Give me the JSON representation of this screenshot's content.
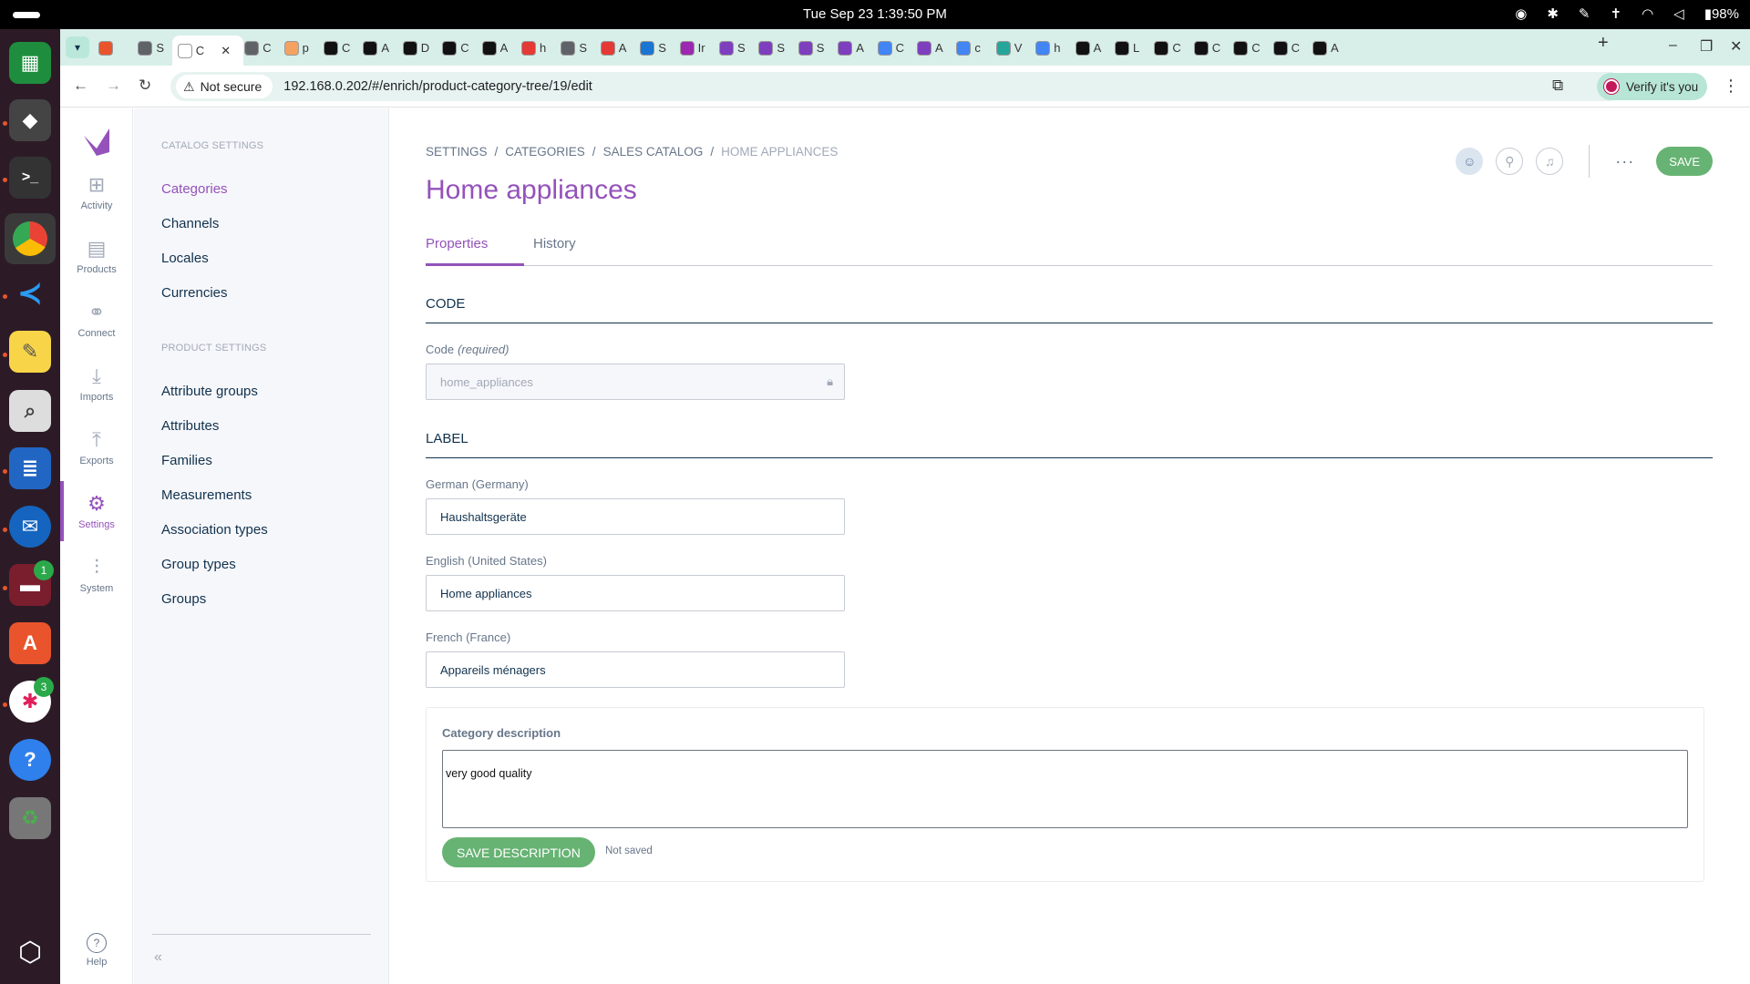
{
  "os": {
    "clock": "Tue Sep 23   1:39:50 PM",
    "battery": "98%"
  },
  "browser": {
    "tabs": [
      {
        "label": "",
        "color": "#e9542c"
      },
      {
        "label": "S",
        "color": "#5f6368"
      },
      {
        "label": "C",
        "color": "#ffffff"
      },
      {
        "label": "C",
        "color": "#5f6368"
      },
      {
        "label": "p",
        "color": "#f4a261"
      },
      {
        "label": "C",
        "color": "#111111"
      },
      {
        "label": "A",
        "color": "#111111"
      },
      {
        "label": "D",
        "color": "#111111"
      },
      {
        "label": "C",
        "color": "#111111"
      },
      {
        "label": "A",
        "color": "#111111"
      },
      {
        "label": "h",
        "color": "#e53935"
      },
      {
        "label": "S",
        "color": "#5f6368"
      },
      {
        "label": "A",
        "color": "#e53935"
      },
      {
        "label": "S",
        "color": "#1976d2"
      },
      {
        "label": "Ir",
        "color": "#9c27b0"
      },
      {
        "label": "S",
        "color": "#7e3fbf"
      },
      {
        "label": "S",
        "color": "#7e3fbf"
      },
      {
        "label": "S",
        "color": "#7e3fbf"
      },
      {
        "label": "A",
        "color": "#7e3fbf"
      },
      {
        "label": "C",
        "color": "#4285f4"
      },
      {
        "label": "A",
        "color": "#7e3fbf"
      },
      {
        "label": "c",
        "color": "#4285f4"
      },
      {
        "label": "V",
        "color": "#26a69a"
      },
      {
        "label": "h",
        "color": "#4285f4"
      },
      {
        "label": "A",
        "color": "#111111"
      },
      {
        "label": "L",
        "color": "#111111"
      },
      {
        "label": "C",
        "color": "#111111"
      },
      {
        "label": "C",
        "color": "#111111"
      },
      {
        "label": "C",
        "color": "#111111"
      },
      {
        "label": "C",
        "color": "#111111"
      },
      {
        "label": "A",
        "color": "#111111"
      }
    ],
    "not_secure": "Not secure",
    "url": "192.168.0.202/#/enrich/product-category-tree/19/edit",
    "verify": "Verify it's you"
  },
  "main_menu": {
    "items": [
      {
        "label": "Activity",
        "icon": "activity-icon"
      },
      {
        "label": "Products",
        "icon": "products-icon"
      },
      {
        "label": "Connect",
        "icon": "connect-icon"
      },
      {
        "label": "Imports",
        "icon": "imports-icon"
      },
      {
        "label": "Exports",
        "icon": "exports-icon"
      },
      {
        "label": "Settings",
        "icon": "settings-icon"
      },
      {
        "label": "System",
        "icon": "system-icon"
      }
    ],
    "help": "Help"
  },
  "settings_panel": {
    "catalog_header": "CATALOG SETTINGS",
    "catalog_links": [
      "Categories",
      "Channels",
      "Locales",
      "Currencies"
    ],
    "product_header": "PRODUCT SETTINGS",
    "product_links": [
      "Attribute groups",
      "Attributes",
      "Families",
      "Measurements",
      "Association types",
      "Group types",
      "Groups"
    ]
  },
  "content": {
    "breadcrumb": [
      "SETTINGS",
      "CATEGORIES",
      "SALES CATALOG",
      "HOME APPLIANCES"
    ],
    "title": "Home appliances",
    "save": "SAVE",
    "tabs": [
      "Properties",
      "History"
    ],
    "code_section": "CODE",
    "code_label": "Code",
    "code_required": "(required)",
    "code_value": "home_appliances",
    "label_section": "LABEL",
    "labels": [
      {
        "locale": "German (Germany)",
        "value": "Haushaltsgeräte"
      },
      {
        "locale": "English (United States)",
        "value": "Home appliances"
      },
      {
        "locale": "French (France)",
        "value": "Appareils ménagers"
      }
    ],
    "description_title": "Category description",
    "description_value": "very good quality",
    "description_save": "SAVE DESCRIPTION",
    "description_status": "Not saved"
  },
  "colors": {
    "brand": "#9452ba",
    "save_green": "#67b373",
    "dock_bg": "#2c1b26",
    "tab_bar": "#d8efe9"
  }
}
